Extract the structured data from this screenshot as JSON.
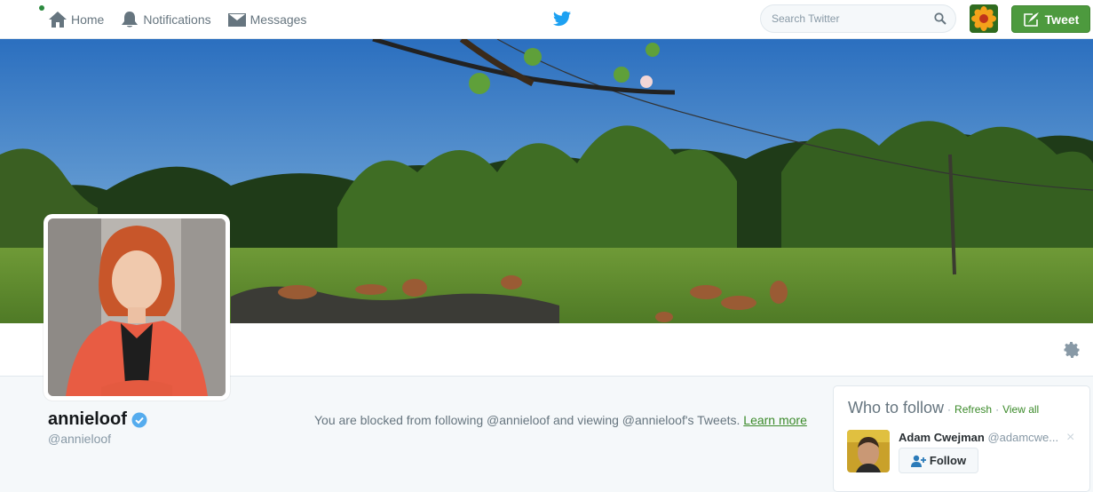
{
  "nav": {
    "items": [
      {
        "label": "Home",
        "icon": "home-icon"
      },
      {
        "label": "Notifications",
        "icon": "bell-icon"
      },
      {
        "label": "Messages",
        "icon": "envelope-icon"
      }
    ]
  },
  "search": {
    "placeholder": "Search Twitter"
  },
  "tweet_button": {
    "label": "Tweet"
  },
  "profile": {
    "fullname": "annieloof",
    "screen_name": "@annieloof"
  },
  "blocked_message": {
    "text": "You are blocked from following @annieloof and viewing @annieloof's Tweets.",
    "link": "Learn more"
  },
  "who_to_follow": {
    "title": "Who to follow",
    "refresh": "Refresh",
    "view_all": "View all",
    "separator": "·",
    "user": {
      "name": "Adam Cwejman",
      "handle": "@adamcwe...",
      "follow_label": "Follow",
      "close": "×"
    }
  },
  "colors": {
    "accent": "#3b8a2a",
    "tweet_button": "#4d9a3e",
    "twitter_blue": "#1da1f2",
    "verified": "#1da1f2"
  }
}
